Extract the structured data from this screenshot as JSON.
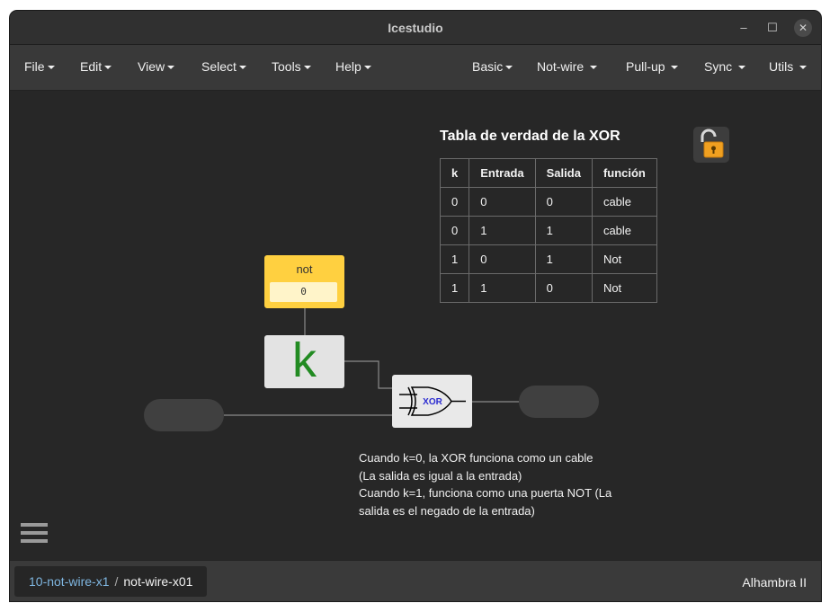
{
  "window": {
    "title": "Icestudio"
  },
  "menu": {
    "left": [
      "File",
      "Edit",
      "View",
      "Select",
      "Tools",
      "Help"
    ],
    "right": [
      "Basic",
      "Not-wire",
      "Pull-up",
      "Sync",
      "Utils"
    ]
  },
  "canvas": {
    "table_title": "Tabla de verdad de la XOR",
    "table": {
      "headers": [
        "k",
        "Entrada",
        "Salida",
        "función"
      ],
      "rows": [
        [
          "0",
          "0",
          "0",
          "cable"
        ],
        [
          "0",
          "1",
          "1",
          "cable"
        ],
        [
          "1",
          "0",
          "1",
          "Not"
        ],
        [
          "1",
          "1",
          "0",
          "Not"
        ]
      ]
    },
    "const_block": {
      "name": "not",
      "value": "0"
    },
    "k_block": {
      "label": "k"
    },
    "xor_block": {
      "label": "XOR"
    },
    "description": [
      "Cuando k=0, la XOR funciona como un cable",
      "(La salida es igual a la entrada)",
      "Cuando k=1, funciona como una puerta NOT (La",
      "salida es el negado de la entrada)"
    ]
  },
  "footer": {
    "breadcrumb_parent": "10-not-wire-x1",
    "breadcrumb_sep": "/",
    "breadcrumb_current": "not-wire-x01",
    "board": "Alhambra II"
  },
  "colors": {
    "const_block": "#ffd040",
    "k_letter": "#228b22",
    "link": "#7fb6e0"
  }
}
